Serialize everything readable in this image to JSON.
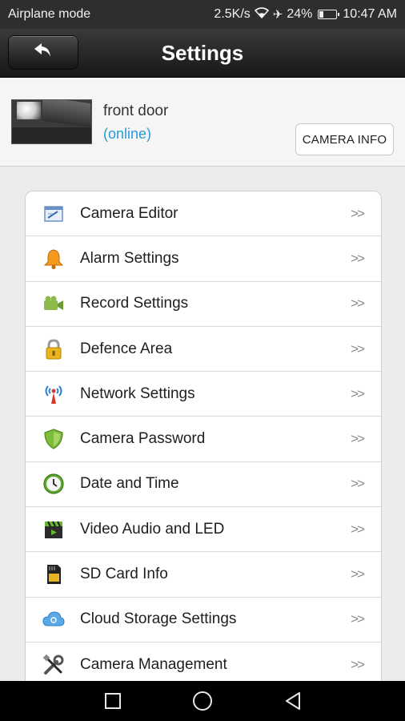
{
  "status_bar": {
    "left_text": "Airplane mode",
    "net_speed": "2.5K/s",
    "battery_pct": "24%",
    "battery_level": 0.24,
    "time": "10:47 AM",
    "icons": [
      "wifi-icon",
      "airplane-icon",
      "battery-icon"
    ]
  },
  "header": {
    "title": "Settings",
    "back_icon": "back-arrow-icon"
  },
  "camera": {
    "name": "front door",
    "status": "(online)",
    "info_button": "CAMERA INFO",
    "status_color": "#2a9ad6"
  },
  "settings": {
    "chevron": ">>",
    "items": [
      {
        "label": "Camera Editor",
        "icon": "camera-editor-icon"
      },
      {
        "label": "Alarm Settings",
        "icon": "alarm-bell-icon"
      },
      {
        "label": "Record Settings",
        "icon": "video-camera-icon"
      },
      {
        "label": "Defence Area",
        "icon": "lock-icon"
      },
      {
        "label": "Network Settings",
        "icon": "network-antenna-icon"
      },
      {
        "label": "Camera Password",
        "icon": "shield-icon"
      },
      {
        "label": "Date and Time",
        "icon": "clock-icon"
      },
      {
        "label": "Video Audio and LED",
        "icon": "clapperboard-icon"
      },
      {
        "label": "SD Card Info",
        "icon": "sd-card-icon"
      },
      {
        "label": "Cloud Storage Settings",
        "icon": "cloud-icon"
      },
      {
        "label": "Camera Management",
        "icon": "tools-icon"
      }
    ]
  },
  "nav_bar": {
    "icons": [
      "recents-square-icon",
      "home-circle-icon",
      "back-triangle-icon"
    ]
  }
}
